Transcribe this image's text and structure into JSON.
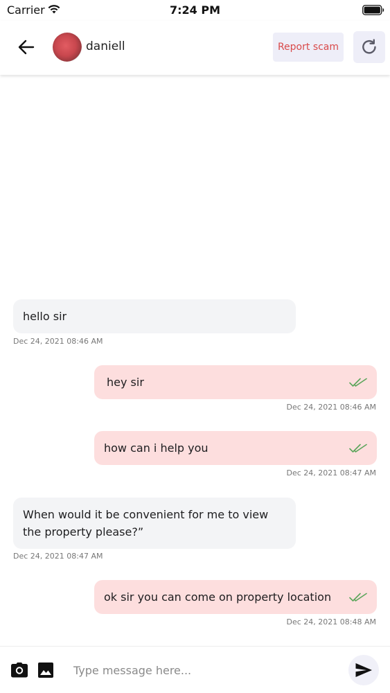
{
  "status_bar": {
    "carrier": "Carrier",
    "time": "7:24 PM"
  },
  "header": {
    "contact_name": "daniell",
    "report_label": "Report scam"
  },
  "messages": [
    {
      "direction": "in",
      "text": "hello sir",
      "time": "Dec 24, 2021 08:46 AM"
    },
    {
      "direction": "out",
      "text": "hey sir",
      "time": "Dec 24, 2021 08:46 AM",
      "read": true
    },
    {
      "direction": "out",
      "text": "how can i help you",
      "time": "Dec 24, 2021 08:47 AM",
      "read": true
    },
    {
      "direction": "in",
      "text": "When would it be convenient for me to view the property please?”",
      "time": "Dec 24, 2021 08:47 AM"
    },
    {
      "direction": "out",
      "text": "ok sir you can come on property location",
      "time": "Dec 24, 2021 08:48 AM",
      "read": true
    }
  ],
  "composer": {
    "placeholder": "Type message here..."
  },
  "colors": {
    "incoming_bubble": "#f3f4f6",
    "outgoing_bubble": "#fddede",
    "report_text": "#d94a4a",
    "read_check": "#5aa55a"
  },
  "icons": {
    "back": "arrow-left-icon",
    "refresh": "refresh-icon",
    "read": "double-check-icon",
    "camera": "camera-icon",
    "gallery": "image-icon",
    "send": "send-icon"
  }
}
